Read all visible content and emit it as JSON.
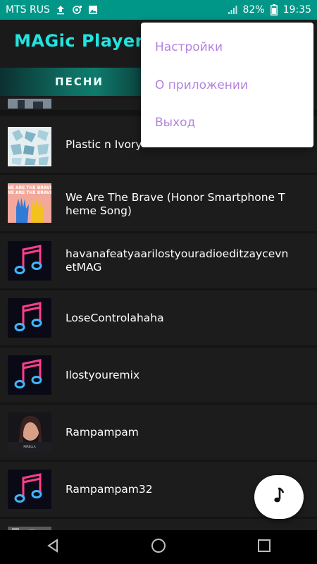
{
  "status_bar": {
    "carrier": "MTS RUS",
    "battery": "82%",
    "time": "19:35",
    "icons": [
      "upload-icon",
      "screen-record-icon",
      "image-icon",
      "signal-icon",
      "battery-icon"
    ]
  },
  "app": {
    "title": "MAGic Player"
  },
  "tabs": [
    {
      "label": "ПЕСНИ",
      "active": true
    }
  ],
  "menu": {
    "items": [
      "Настройки",
      "О приложении",
      "Выход"
    ]
  },
  "songs": [
    {
      "title": "",
      "art": "partial-cover"
    },
    {
      "title": "Plastic n Ivory",
      "art": "blue-pattern-cover"
    },
    {
      "title": "We Are The Brave (Honor Smartphone Theme Song)",
      "art": "we-are-the-brave-cover",
      "art_text": "WE ARE THE BRAVE"
    },
    {
      "title": "havanafeatyaarilostyouradioeditzaycevnetMAG",
      "art": "neon-note-cover"
    },
    {
      "title": "LoseControlahaha",
      "art": "neon-note-cover"
    },
    {
      "title": "Ilostyouremix",
      "art": "neon-note-cover"
    },
    {
      "title": "Rampampam",
      "art": "portrait-cover"
    },
    {
      "title": "Rampampam32",
      "art": "neon-note-cover"
    },
    {
      "title": "",
      "art": "partial-cover"
    }
  ],
  "fab": {
    "icon": "music-note-icon"
  },
  "nav": {
    "icons": [
      "back-icon",
      "home-icon",
      "recents-icon"
    ]
  },
  "colors": {
    "status_bar": "#009688",
    "title": "#22e4e0",
    "menu_text": "#b383df",
    "background": "#141414"
  }
}
